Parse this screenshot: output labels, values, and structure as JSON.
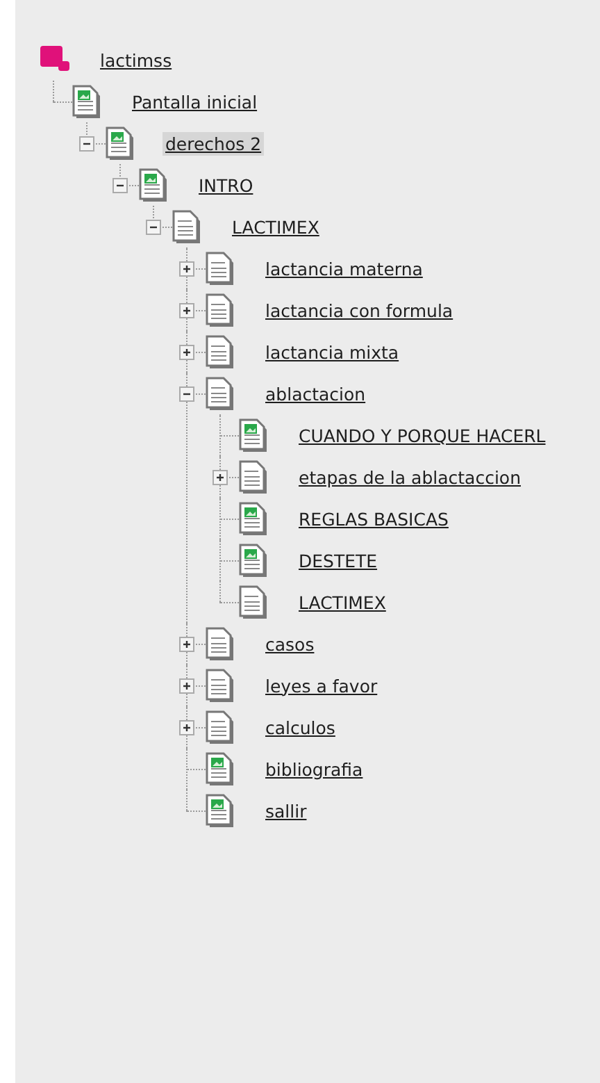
{
  "tree": {
    "label": "lactimss",
    "kind": "root",
    "selected": false,
    "children": [
      {
        "label": "Pantalla inicial",
        "kind": "image-page",
        "selected": false,
        "children": [
          {
            "label": "derechos 2",
            "kind": "image-page",
            "selected": true,
            "expanded": true,
            "children": [
              {
                "label": "INTRO",
                "kind": "image-page",
                "selected": false,
                "expanded": true,
                "children": [
                  {
                    "label": "LACTIMEX",
                    "kind": "page",
                    "selected": false,
                    "expanded": true,
                    "children": [
                      {
                        "label": "lactancia materna",
                        "kind": "page",
                        "selected": false,
                        "expanded": false
                      },
                      {
                        "label": "lactancia con formula",
                        "kind": "page",
                        "selected": false,
                        "expanded": false
                      },
                      {
                        "label": "lactancia mixta",
                        "kind": "page",
                        "selected": false,
                        "expanded": false
                      },
                      {
                        "label": "ablactacion",
                        "kind": "page",
                        "selected": false,
                        "expanded": true,
                        "children": [
                          {
                            "label": "CUANDO Y PORQUE HACERL",
                            "kind": "image-page",
                            "selected": false
                          },
                          {
                            "label": "etapas de la ablactaccion",
                            "kind": "page",
                            "selected": false,
                            "expanded": false
                          },
                          {
                            "label": "REGLAS BASICAS",
                            "kind": "image-page",
                            "selected": false
                          },
                          {
                            "label": "DESTETE",
                            "kind": "image-page",
                            "selected": false
                          },
                          {
                            "label": "LACTIMEX",
                            "kind": "page",
                            "selected": false
                          }
                        ]
                      },
                      {
                        "label": "casos",
                        "kind": "page",
                        "selected": false,
                        "expanded": false
                      },
                      {
                        "label": "leyes a favor",
                        "kind": "page",
                        "selected": false,
                        "expanded": false
                      },
                      {
                        "label": "calculos",
                        "kind": "page",
                        "selected": false,
                        "expanded": false
                      },
                      {
                        "label": "bibliografia",
                        "kind": "image-page",
                        "selected": false
                      },
                      {
                        "label": "sallir",
                        "kind": "image-page",
                        "selected": false
                      }
                    ]
                  }
                ]
              }
            ]
          }
        ]
      }
    ]
  }
}
